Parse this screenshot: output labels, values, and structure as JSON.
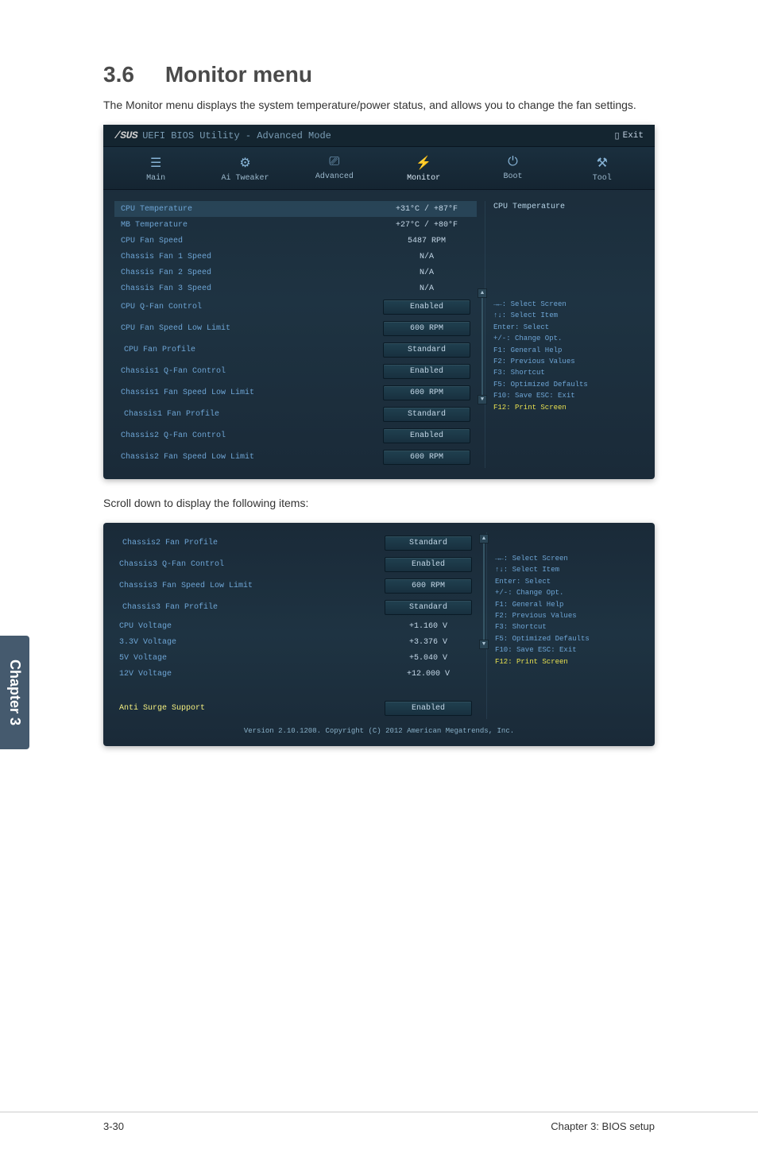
{
  "section": {
    "number": "3.6",
    "title": "Monitor menu",
    "description": "The Monitor menu displays the system temperature/power status, and allows you to change the fan settings."
  },
  "bios": {
    "brand": "/SUS",
    "title": "UEFI BIOS Utility - Advanced Mode",
    "exit": "Exit",
    "tabs": [
      {
        "icon": "☰",
        "label": "Main"
      },
      {
        "icon": "⚙",
        "label": "Ai Tweaker"
      },
      {
        "icon": "⎚",
        "label": "Advanced"
      },
      {
        "icon": "⚡",
        "label": "Monitor"
      },
      {
        "icon": "⏻",
        "label": "Boot"
      },
      {
        "icon": "⚒",
        "label": "Tool"
      }
    ],
    "rows1": [
      {
        "label": "CPU Temperature",
        "value": "+31°C / +87°F",
        "selected": true
      },
      {
        "label": "MB Temperature",
        "value": "+27°C / +80°F"
      },
      {
        "label": "CPU Fan Speed",
        "value": "5487 RPM"
      },
      {
        "label": "Chassis Fan 1 Speed",
        "value": "N/A"
      },
      {
        "label": "Chassis Fan 2 Speed",
        "value": "N/A"
      },
      {
        "label": "Chassis Fan 3 Speed",
        "value": "N/A"
      },
      {
        "label": "CPU Q-Fan Control",
        "value": "Enabled",
        "btn": true
      },
      {
        "label": "CPU Fan Speed Low Limit",
        "value": "600 RPM",
        "btn": true
      },
      {
        "label": "CPU Fan Profile",
        "value": "Standard",
        "btn": true,
        "sub": true
      },
      {
        "label": "Chassis1 Q-Fan Control",
        "value": "Enabled",
        "btn": true
      },
      {
        "label": "Chassis1 Fan Speed Low Limit",
        "value": "600 RPM",
        "btn": true
      },
      {
        "label": "Chassis1 Fan Profile",
        "value": "Standard",
        "btn": true,
        "sub": true
      },
      {
        "label": "Chassis2 Q-Fan Control",
        "value": "Enabled",
        "btn": true
      },
      {
        "label": "Chassis2 Fan Speed Low Limit",
        "value": "600 RPM",
        "btn": true
      }
    ],
    "help_title_1": "CPU Temperature",
    "help_lines": [
      "→←: Select Screen",
      "↑↓: Select Item",
      "Enter: Select",
      "+/-: Change Opt.",
      "F1: General Help",
      "F2: Previous Values",
      "F3: Shortcut",
      "F5: Optimized Defaults",
      "F10: Save  ESC: Exit",
      "F12: Print Screen"
    ]
  },
  "scroll_text": "Scroll down to display the following items:",
  "bios2": {
    "rows": [
      {
        "label": "Chassis2 Fan Profile",
        "value": "Standard",
        "btn": true,
        "sub": true
      },
      {
        "label": "Chassis3 Q-Fan Control",
        "value": "Enabled",
        "btn": true
      },
      {
        "label": "Chassis3 Fan Speed Low Limit",
        "value": "600 RPM",
        "btn": true
      },
      {
        "label": "Chassis3 Fan Profile",
        "value": "Standard",
        "btn": true,
        "sub": true
      },
      {
        "label": "CPU Voltage",
        "value": "+1.160 V"
      },
      {
        "label": "3.3V Voltage",
        "value": "+3.376 V"
      },
      {
        "label": "5V Voltage",
        "value": "+5.040 V"
      },
      {
        "label": "12V Voltage",
        "value": "+12.000 V"
      },
      {
        "label": "",
        "value": ""
      },
      {
        "label": "Anti Surge Support",
        "value": "Enabled",
        "btn": true,
        "highlighted": true
      }
    ],
    "footer": "Version 2.10.1208. Copyright (C) 2012 American Megatrends, Inc."
  },
  "chapter_tab": "Chapter 3",
  "footer": {
    "left": "3-30",
    "right": "Chapter 3: BIOS setup"
  }
}
